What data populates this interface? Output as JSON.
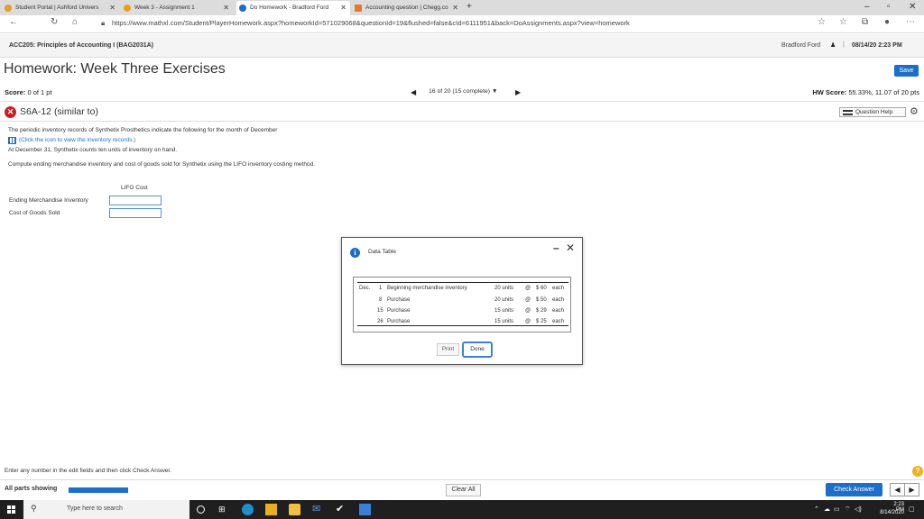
{
  "browser": {
    "tabs": [
      {
        "label": "Student Portal | Ashford Univers",
        "active": false
      },
      {
        "label": "Week 3 - Assignment 1",
        "active": false
      },
      {
        "label": "Do Homework - Bradford Ford",
        "active": true
      },
      {
        "label": "Accounting question | Chegg.co",
        "active": false
      }
    ],
    "url": "https://www.mathxl.com/Student/PlayerHomework.aspx?homeworkId=571029068&questionId=19&flushed=false&cId=6111951&back=DoAssignments.aspx?view=homework"
  },
  "course": {
    "title": "ACC205: Principles of Accounting I (BAG2031A)",
    "user": "Bradford Ford",
    "datetime": "08/14/20 2:23 PM"
  },
  "homework": {
    "title": "Homework: Week Three Exercises",
    "save_label": "Save",
    "score_label": "Score:",
    "score_value": "0 of 1 pt",
    "progress": "16 of 20 (15 complete)",
    "hw_score_label": "HW Score:",
    "hw_score_value": "55.33%, 11.07 of 20 pts"
  },
  "question": {
    "id": "S6A-12 (similar to)",
    "help_label": "Question Help",
    "intro": "The periodic inventory records of Synthetix Prosthetics indicate the following for the month of December",
    "icon_link": "(Click the icon to view the inventory records.)",
    "count_text": "At December 31, Synthetix counts ten units of inventory on hand.",
    "instruction": "Compute ending merchandise inventory and cost of goods sold for Synthetix using the LIFO inventory costing method.",
    "column_header": "LIFO Cost",
    "rows": [
      {
        "label": "Ending Merchandise Inventory",
        "value": ""
      },
      {
        "label": "Cost of Goods Sold",
        "value": ""
      }
    ]
  },
  "modal": {
    "title": "Data Table",
    "print_label": "Print",
    "done_label": "Done",
    "records": [
      {
        "month": "Dec.",
        "day": "1",
        "desc": "Beginning merchandise inventory",
        "units": "20 units",
        "at": "@",
        "price": "$ 60",
        "each": "each"
      },
      {
        "month": "",
        "day": "8",
        "desc": "Purchase",
        "units": "20 units",
        "at": "@",
        "price": "$ 50",
        "each": "each"
      },
      {
        "month": "",
        "day": "15",
        "desc": "Purchase",
        "units": "15 units",
        "at": "@",
        "price": "$ 29",
        "each": "each"
      },
      {
        "month": "",
        "day": "26",
        "desc": "Purchase",
        "units": "15 units",
        "at": "@",
        "price": "$ 25",
        "each": "each"
      }
    ]
  },
  "footer": {
    "hint": "Enter any number in the edit fields and then click Check Answer.",
    "parts_label": "All parts showing",
    "clear_label": "Clear All",
    "check_label": "Check Answer"
  },
  "taskbar": {
    "search_placeholder": "Type here to search",
    "time": "2:23 PM",
    "date": "8/14/2020"
  },
  "colors": {
    "accent": "#1c6fc8",
    "error": "#c81e1e"
  }
}
